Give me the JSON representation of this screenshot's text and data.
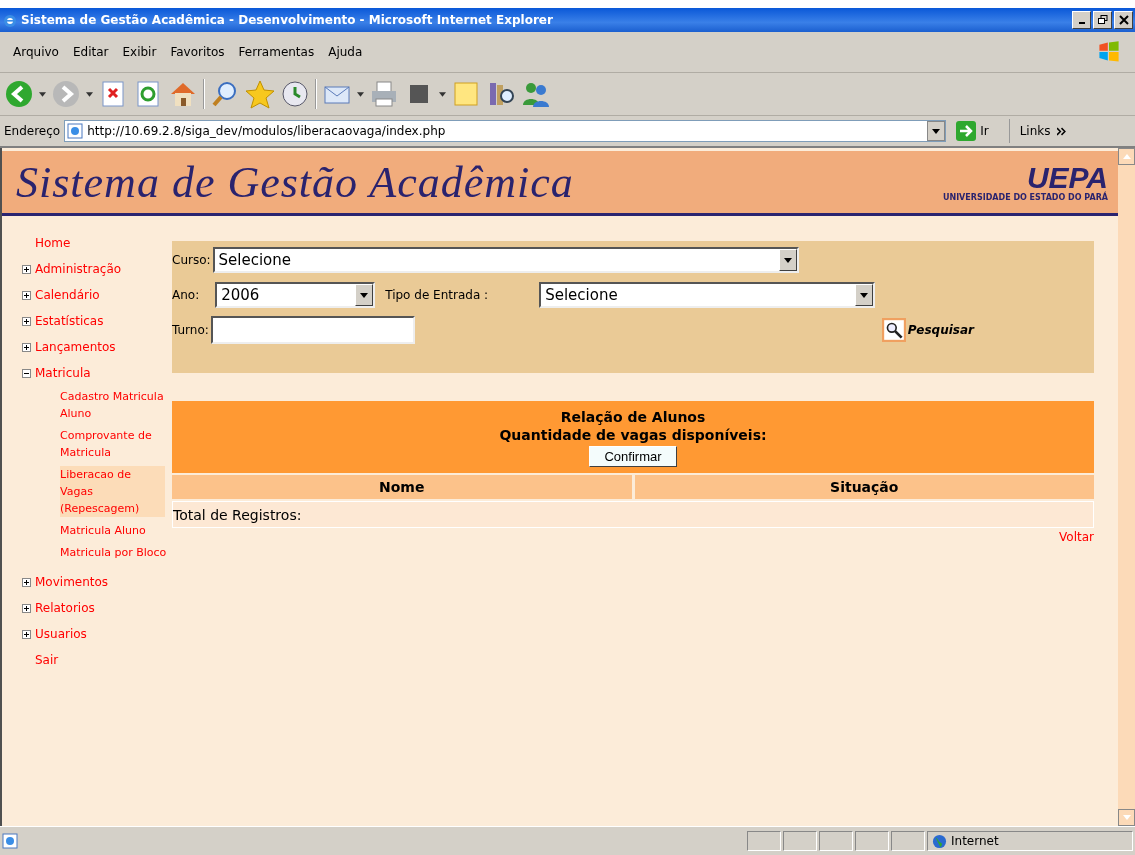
{
  "window": {
    "title": "Sistema de Gestão Acadêmica - Desenvolvimento - Microsoft Internet Explorer"
  },
  "menu_bar": [
    "Arquivo",
    "Editar",
    "Exibir",
    "Favoritos",
    "Ferramentas",
    "Ajuda"
  ],
  "address_bar": {
    "label": "Endereço",
    "url": "http://10.69.2.8/siga_dev/modulos/liberacaovaga/index.php",
    "go": "Ir",
    "links": "Links"
  },
  "banner": {
    "title": "Sistema de Gestão Acadêmica",
    "logo": "UEPA",
    "logo_caption": "UNIVERSIDADE DO ESTADO DO PARÁ"
  },
  "sidebar": {
    "items": [
      {
        "label": "Home",
        "kind": "link"
      },
      {
        "label": "Administração",
        "kind": "group",
        "expanded": false
      },
      {
        "label": "Calendário",
        "kind": "group",
        "expanded": false
      },
      {
        "label": "Estatísticas",
        "kind": "group",
        "expanded": false
      },
      {
        "label": "Lançamentos",
        "kind": "group",
        "expanded": false
      },
      {
        "label": "Matricula",
        "kind": "group",
        "expanded": true,
        "children": [
          {
            "label": "Cadastro Matricula Aluno",
            "selected": false
          },
          {
            "label": "Comprovante de Matricula",
            "selected": false
          },
          {
            "label": "Liberacao de Vagas (Repescagem)",
            "selected": true
          },
          {
            "label": "Matricula Aluno",
            "selected": false
          },
          {
            "label": "Matricula por Bloco",
            "selected": false
          }
        ]
      },
      {
        "label": "Movimentos",
        "kind": "group",
        "expanded": false
      },
      {
        "label": "Relatorios",
        "kind": "group",
        "expanded": false
      },
      {
        "label": "Usuarios",
        "kind": "group",
        "expanded": false
      },
      {
        "label": "Sair",
        "kind": "link"
      }
    ]
  },
  "filters": {
    "curso": {
      "label": "Curso:",
      "value": "Selecione"
    },
    "ano": {
      "label": "Ano:",
      "value": "2006"
    },
    "tipo_entrada": {
      "label": "Tipo de Entrada :",
      "value": "Selecione"
    },
    "turno": {
      "label": "Turno:"
    },
    "search_button": "Pesquisar"
  },
  "results": {
    "title": "Relação de Alunos",
    "subtitle": "Quantidade de vagas disponíveis:",
    "confirm_button": "Confirmar",
    "columns": [
      "Nome",
      "Situação"
    ],
    "total": "Total de Registros:",
    "back_link": "Voltar"
  },
  "status_bar": {
    "zone": "Internet"
  }
}
